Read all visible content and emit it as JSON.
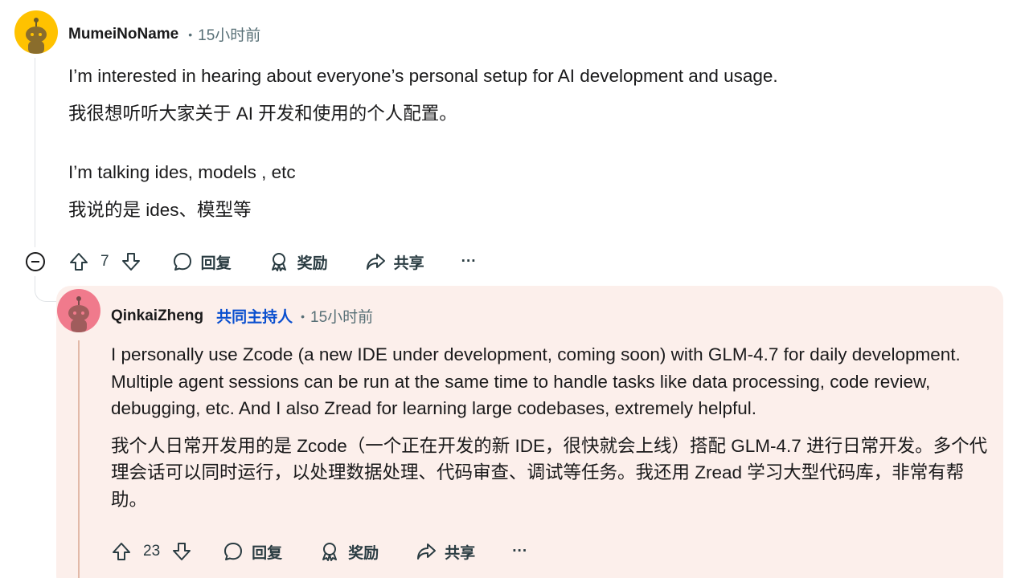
{
  "colors": {
    "flair": "#0a4fcf",
    "reply_bg": "#fcefeb",
    "avatar_top": "#ffc200",
    "avatar_reply": "#f07a8c"
  },
  "comment": {
    "author": "MumeiNoName",
    "time": "15小时前",
    "paragraphs": [
      "I’m interested in hearing about everyone’s personal setup for AI development and usage.",
      "我很想听听大家关于 AI 开发和使用的个人配置。",
      "I’m talking ides, models , etc",
      "我说的是 ides、模型等"
    ],
    "votes": "7",
    "reply_label": "回复",
    "award_label": "奖励",
    "share_label": "共享",
    "more_label": "···"
  },
  "reply": {
    "author": "QinkaiZheng",
    "flair": "共同主持人",
    "time": "15小时前",
    "paragraphs": [
      "I personally use Zcode (a new IDE under development, coming soon) with GLM-4.7 for daily development. Multiple agent sessions can be run at the same time to handle tasks like data processing, code review, debugging, etc. And I also Zread for learning large codebases, extremely helpful.",
      "我个人日常开发用的是 Zcode（一个正在开发的新 IDE，很快就会上线）搭配 GLM-4.7 进行日常开发。多个代理会话可以同时运行，以处理数据处理、代码审查、调试等任务。我还用 Zread 学习大型代码库，非常有帮助。"
    ],
    "votes": "23",
    "reply_label": "回复",
    "award_label": "奖励",
    "share_label": "共享",
    "more_label": "···"
  }
}
